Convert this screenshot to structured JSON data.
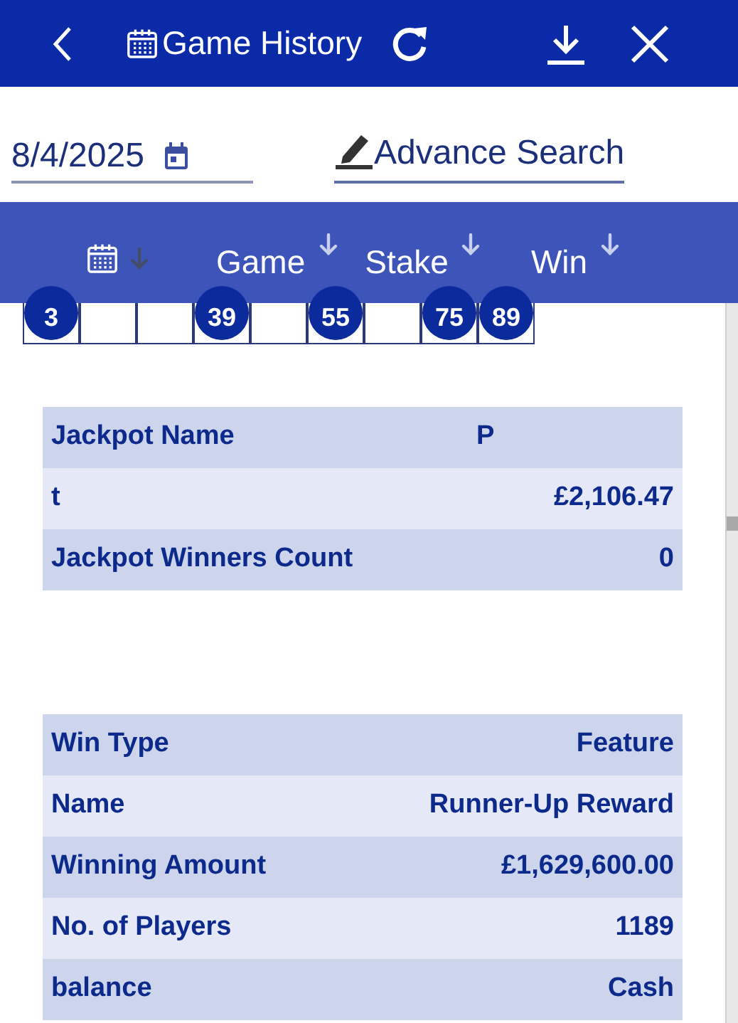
{
  "header": {
    "title": "Game History"
  },
  "filter": {
    "date": "8/4/2025",
    "advance_search": "Advance Search"
  },
  "columns": [
    {
      "kind": "icon",
      "selected": true
    },
    {
      "kind": "text",
      "label": "Game",
      "selected": false
    },
    {
      "kind": "text",
      "label": "Stake",
      "selected": false
    },
    {
      "kind": "text",
      "label": "Win",
      "selected": false
    }
  ],
  "balls": [
    {
      "kind": "ball",
      "number": "3"
    },
    {
      "kind": "empty"
    },
    {
      "kind": "empty"
    },
    {
      "kind": "ball",
      "number": "39"
    },
    {
      "kind": "empty"
    },
    {
      "kind": "ball",
      "number": "55"
    },
    {
      "kind": "empty"
    },
    {
      "kind": "ball",
      "number": "75"
    },
    {
      "kind": "ball",
      "number": "89"
    }
  ],
  "jackpot_table": [
    {
      "label": "Jackpot Name",
      "value": "P",
      "kind": "centered"
    },
    {
      "label": "t",
      "value": "£2,106.47",
      "kind": "split"
    },
    {
      "label": "Jackpot Winners Count",
      "value": "0",
      "kind": "split"
    }
  ],
  "win_table": [
    {
      "label": "Win Type",
      "value": "Feature",
      "kind": "split"
    },
    {
      "label": "Name",
      "value": "Runner-Up Reward",
      "kind": "split"
    },
    {
      "label": "Winning Amount",
      "value": "£1,629,600.00",
      "kind": "split"
    },
    {
      "label": "No. of Players",
      "value": "1189",
      "kind": "split"
    },
    {
      "label": "balance",
      "value": "Cash",
      "kind": "split"
    }
  ]
}
